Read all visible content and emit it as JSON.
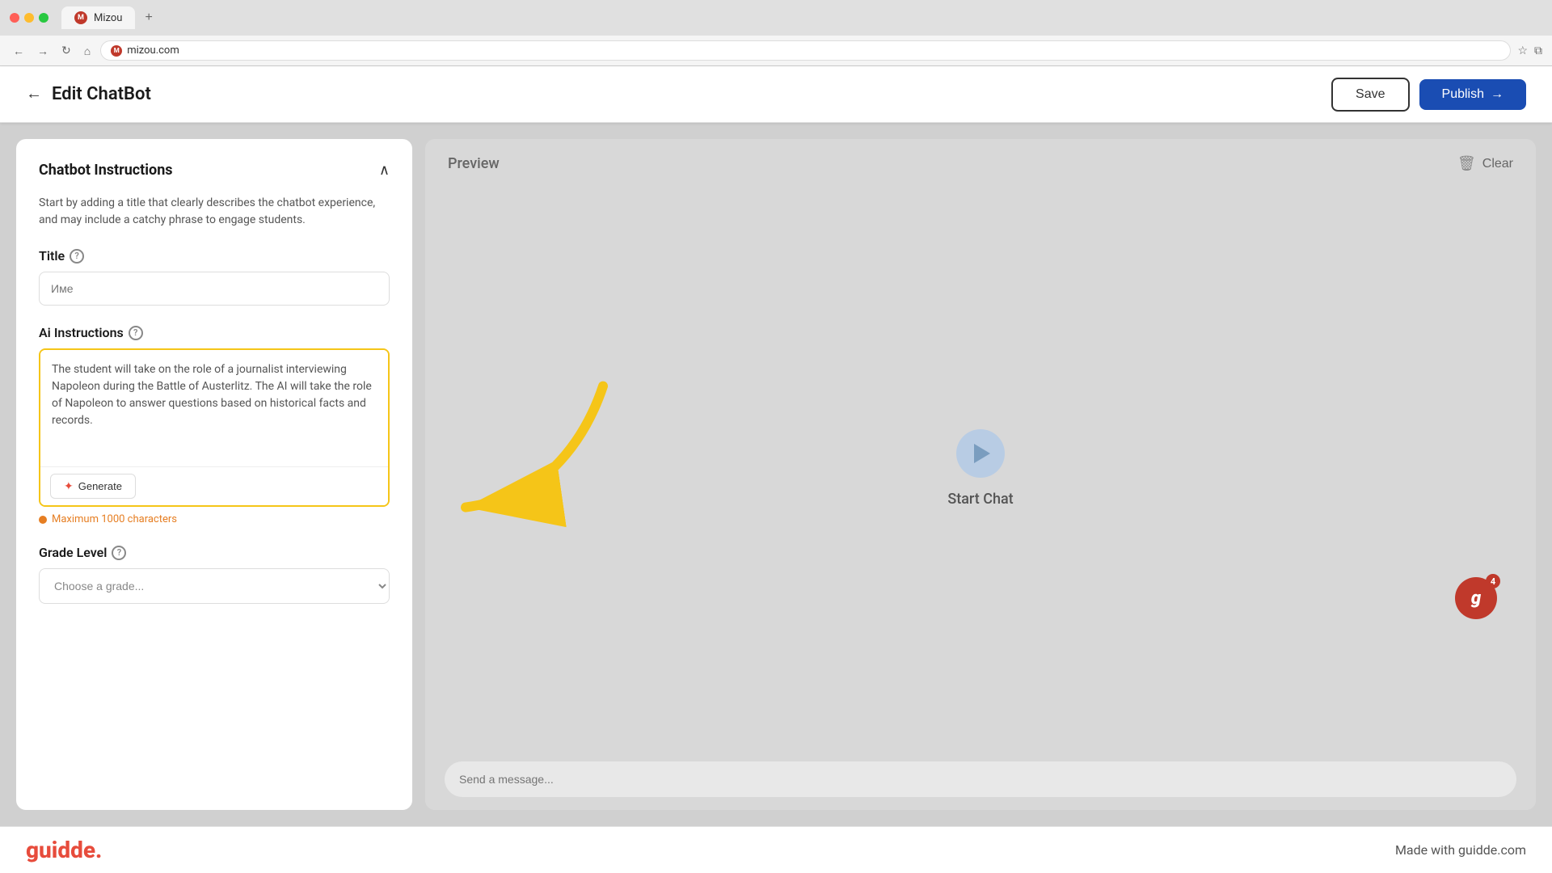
{
  "browser": {
    "tab_title": "Mizou",
    "tab_logo": "M",
    "url": "mizou.com",
    "new_tab_label": "+"
  },
  "header": {
    "back_label": "←",
    "page_title": "Edit ChatBot",
    "save_label": "Save",
    "publish_label": "Publish",
    "publish_icon": "→"
  },
  "left_panel": {
    "section_title": "Chatbot Instructions",
    "section_desc": "Start by adding a title that clearly describes the chatbot experience, and may include a catchy phrase to engage students.",
    "title_label": "Title",
    "title_placeholder": "Име",
    "ai_instructions_label": "Ai Instructions",
    "ai_instructions_value": "The student will take on the role of a journalist interviewing Napoleon during the Battle of Austerlitz. The AI will take the role of Napoleon to answer questions based on historical facts and records.",
    "generate_label": "Generate",
    "char_limit_label": "Maximum 1000 characters",
    "grade_label": "Grade Level",
    "grade_placeholder": "Choose a grade..."
  },
  "right_panel": {
    "preview_title": "Preview",
    "clear_label": "Clear",
    "start_chat_label": "Start Chat",
    "message_placeholder": "Send a message..."
  },
  "footer": {
    "logo_text": "guidde.",
    "credit_text": "Made with guidde.com"
  },
  "icons": {
    "collapse": "∧",
    "help": "?",
    "generate_star": "✦",
    "clear_icon": "🗑",
    "back_arrow": "←"
  }
}
